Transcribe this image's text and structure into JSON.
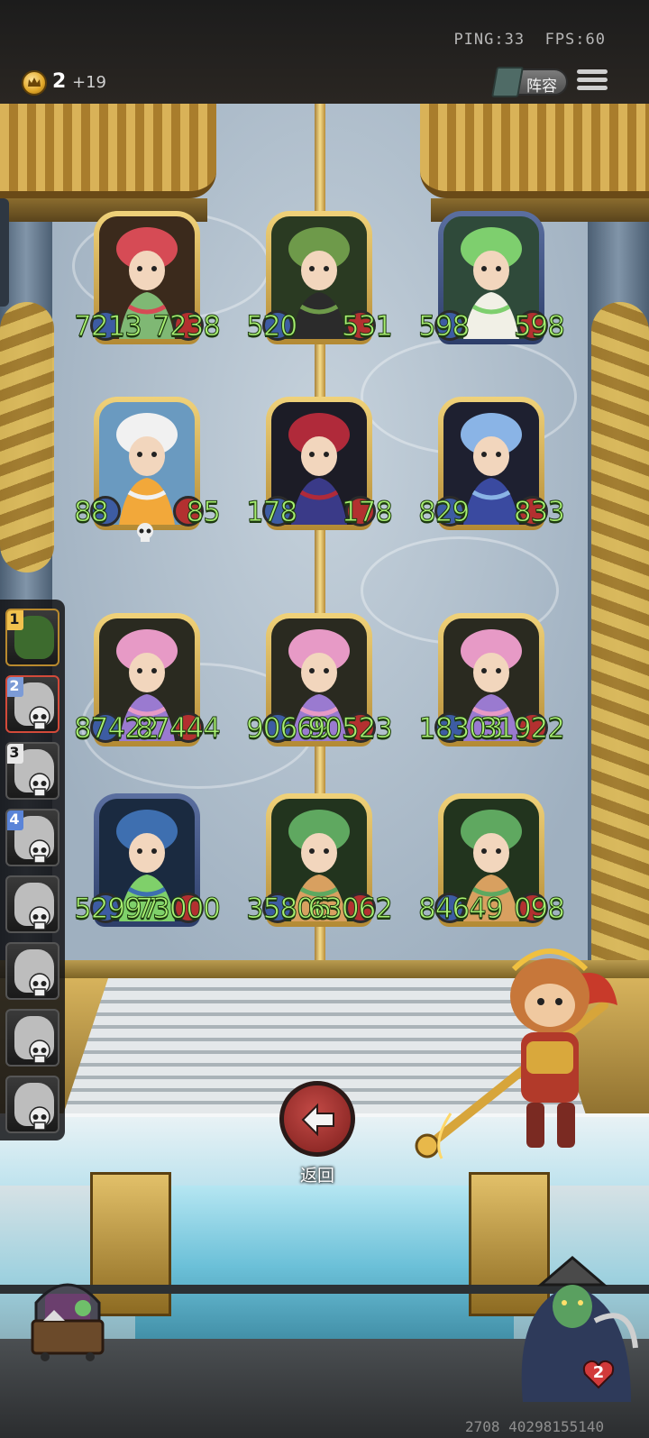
{
  "status": {
    "ping": "PING:33",
    "fps": "FPS:60"
  },
  "currency": {
    "icon": "crown-coin-icon",
    "count": "2",
    "bonus": "+19"
  },
  "header": {
    "lineup_label": "阵容",
    "lineup_icon": "book-icon",
    "menu_icon": "menu-icon"
  },
  "board": {
    "cards": [
      {
        "hp": "7213",
        "atk": "7238",
        "frame": "gold",
        "portrait": "mushroom-girl",
        "bg": "#3b2a1c",
        "main": "#d64b55",
        "accent": "#7fb874"
      },
      {
        "hp": "520",
        "atk": "531",
        "frame": "gold",
        "portrait": "cactus-witch",
        "bg": "#2a3a22",
        "main": "#6e9a4a",
        "accent": "#2b2b2b"
      },
      {
        "hp": "598",
        "atk": "598",
        "frame": "blue",
        "portrait": "dryad",
        "bg": "#2f4a3a",
        "main": "#7ecf6e",
        "accent": "#f1f0e6"
      },
      {
        "hp": "88",
        "atk": "85",
        "frame": "gold",
        "portrait": "pelican",
        "bg": "#6a9ac0",
        "main": "#f1f1f1",
        "accent": "#f2a83a",
        "skull": true
      },
      {
        "hp": "178",
        "atk": "178",
        "frame": "gold",
        "portrait": "jester",
        "bg": "#1c1c26",
        "main": "#b02a3a",
        "accent": "#3a3a88"
      },
      {
        "hp": "829",
        "atk": "833",
        "frame": "gold",
        "portrait": "blue-fairy",
        "bg": "#1e2030",
        "main": "#8ab4e6",
        "accent": "#3a4aa0"
      },
      {
        "hp": "87422",
        "atk": "87444",
        "frame": "gold",
        "portrait": "lotus-girl",
        "bg": "#2a2a20",
        "main": "#e79ac6",
        "accent": "#9a7ad0"
      },
      {
        "hp": "90669",
        "atk": "90523",
        "frame": "gold",
        "portrait": "lotus-girl",
        "bg": "#2a2a20",
        "main": "#e79ac6",
        "accent": "#9a7ad0"
      },
      {
        "hp": "18303",
        "atk": "31922",
        "frame": "gold",
        "portrait": "lotus-girl",
        "bg": "#2a2a20",
        "main": "#e79ac6",
        "accent": "#9a7ad0"
      },
      {
        "hp": "52997",
        "atk": "73000",
        "frame": "blue",
        "portrait": "blue-goblin",
        "bg": "#1a2a40",
        "main": "#3e6fb0",
        "accent": "#7fd06a"
      },
      {
        "hp": "35806",
        "atk": "63062",
        "frame": "gold",
        "portrait": "leaf-fairy",
        "bg": "#22341e",
        "main": "#5fa860",
        "accent": "#d8a060"
      },
      {
        "hp": "84649",
        "atk": "098",
        "frame": "gold",
        "portrait": "leaf-fairy",
        "bg": "#22341e",
        "main": "#5fa860",
        "accent": "#d8a060"
      }
    ]
  },
  "roster": {
    "slots": [
      {
        "num": "1",
        "state": "active"
      },
      {
        "num": "2",
        "state": "selected",
        "dead": true
      },
      {
        "num": "3",
        "state": "dead",
        "dead": true
      },
      {
        "num": "4",
        "state": "dead",
        "dead": true
      },
      {
        "num": "",
        "state": "dead",
        "dead": true
      },
      {
        "num": "",
        "state": "dead",
        "dead": true
      },
      {
        "num": "",
        "state": "dead",
        "dead": true
      },
      {
        "num": "",
        "state": "dead",
        "dead": true
      }
    ]
  },
  "actions": {
    "back_label": "返回",
    "back_icon": "arrow-left-icon"
  },
  "player": {
    "lives": "2",
    "footer_id": "2708 40298155140"
  }
}
